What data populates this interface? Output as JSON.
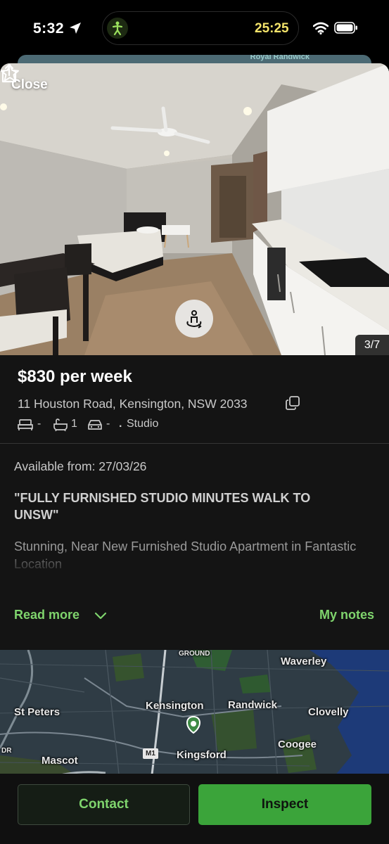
{
  "status_bar": {
    "time": "5:32",
    "timer": "25:25",
    "timer_color": "#f3e36a",
    "icons": [
      "location-arrow-icon",
      "fitness-activity-icon",
      "wifi-icon",
      "battery-icon"
    ]
  },
  "background_map_label": "Royal Randwick",
  "gallery": {
    "close_label": "Close",
    "counter": "3/7",
    "icons": [
      "share-icon",
      "star-icon",
      "virtual-tour-icon"
    ]
  },
  "listing": {
    "price": "$830 per week",
    "address": "11 Houston Road, Kensington, NSW 2033",
    "features": {
      "bedrooms": "-",
      "bathrooms": "1",
      "parking": "-",
      "property_type": "Studio"
    },
    "available_from": "Available from: 27/03/26",
    "headline": "\"FULLY FURNISHED STUDIO MINUTES WALK TO UNSW\"",
    "description": "Stunning, Near New Furnished Studio Apartment in Fantastic Location",
    "read_more_label": "Read more",
    "my_notes_label": "My notes"
  },
  "map": {
    "labels": {
      "ground": "GROUND",
      "waverley": "Waverley",
      "st_peters": "St Peters",
      "kensington": "Kensington",
      "randwick": "Randwick",
      "clovelly": "Clovelly",
      "coogee": "Coogee",
      "mascot": "Mascot",
      "kingsford": "Kingsford",
      "m1": "M1",
      "dr": "DR"
    }
  },
  "actions": {
    "contact_label": "Contact",
    "inspect_label": "Inspect"
  },
  "colors": {
    "accent_green": "#7fd46d",
    "button_green": "#3ba43a",
    "surface": "#141414"
  }
}
